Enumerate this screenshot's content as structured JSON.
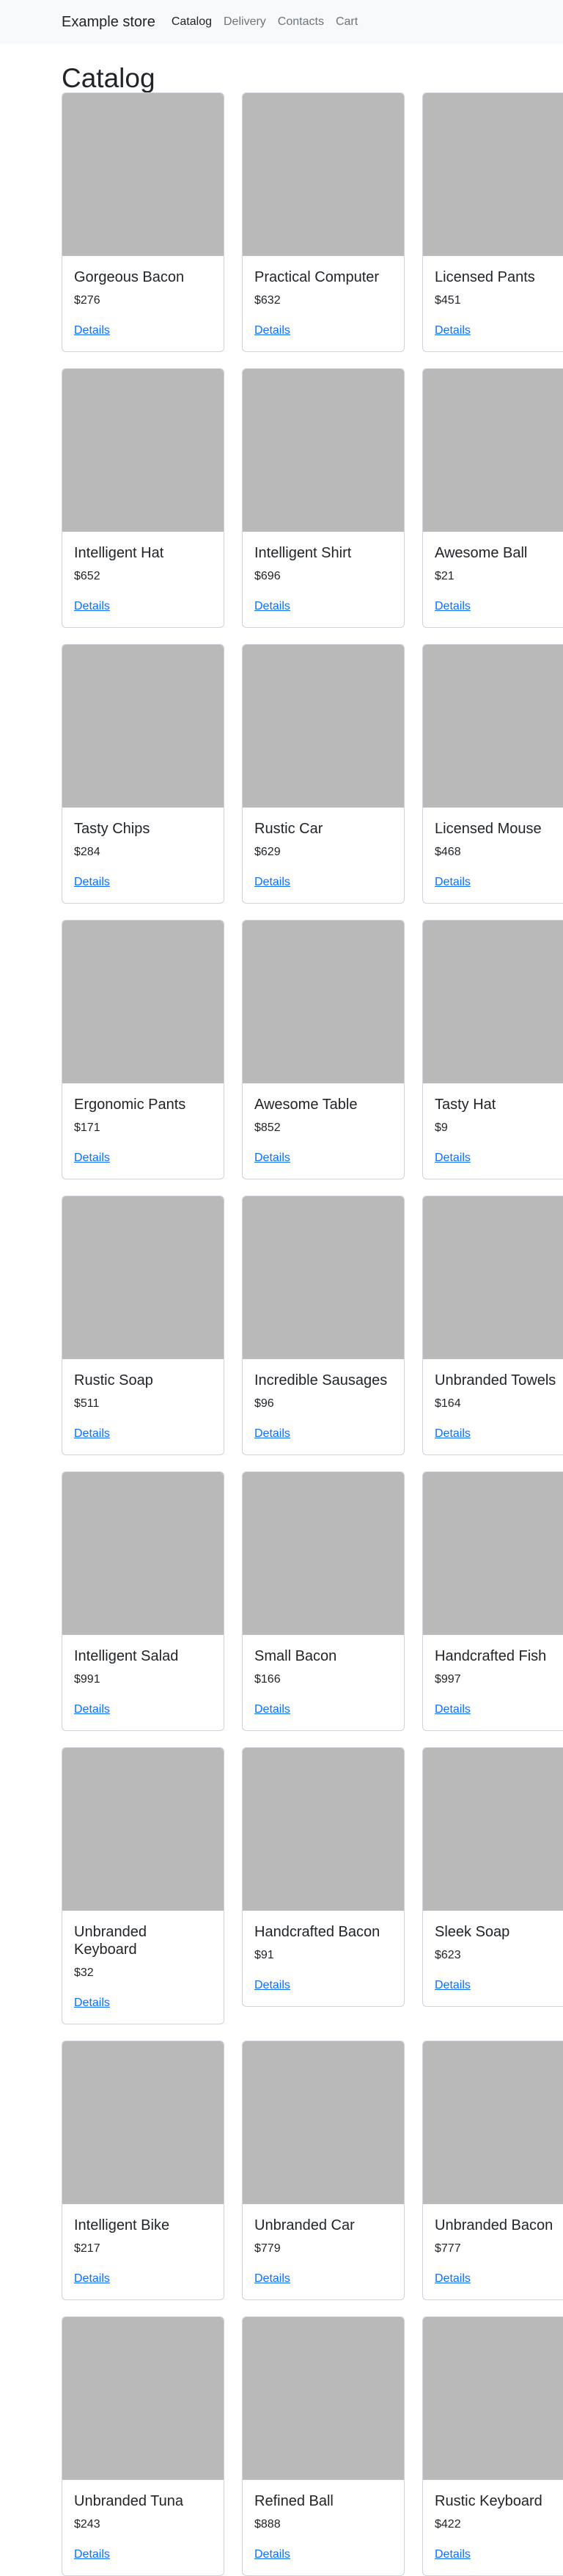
{
  "nav": {
    "brand": "Example store",
    "links": [
      "Catalog",
      "Delivery",
      "Contacts",
      "Cart"
    ]
  },
  "page": {
    "title": "Catalog"
  },
  "products": [
    {
      "name": "Gorgeous Bacon",
      "price": "$276",
      "link": "Details"
    },
    {
      "name": "Practical Computer",
      "price": "$632",
      "link": "Details"
    },
    {
      "name": "Licensed Pants",
      "price": "$451",
      "link": "Details"
    },
    {
      "name": "Intelligent Hat",
      "price": "$652",
      "link": "Details"
    },
    {
      "name": "Intelligent Shirt",
      "price": "$696",
      "link": "Details"
    },
    {
      "name": "Awesome Ball",
      "price": "$21",
      "link": "Details"
    },
    {
      "name": "Tasty Chips",
      "price": "$284",
      "link": "Details"
    },
    {
      "name": "Rustic Car",
      "price": "$629",
      "link": "Details"
    },
    {
      "name": "Licensed Mouse",
      "price": "$468",
      "link": "Details"
    },
    {
      "name": "Ergonomic Pants",
      "price": "$171",
      "link": "Details"
    },
    {
      "name": "Awesome Table",
      "price": "$852",
      "link": "Details"
    },
    {
      "name": "Tasty Hat",
      "price": "$9",
      "link": "Details"
    },
    {
      "name": "Rustic Soap",
      "price": "$511",
      "link": "Details"
    },
    {
      "name": "Incredible Sausages",
      "price": "$96",
      "link": "Details"
    },
    {
      "name": "Unbranded Towels",
      "price": "$164",
      "link": "Details"
    },
    {
      "name": "Intelligent Salad",
      "price": "$991",
      "link": "Details"
    },
    {
      "name": "Small Bacon",
      "price": "$166",
      "link": "Details"
    },
    {
      "name": "Handcrafted Fish",
      "price": "$997",
      "link": "Details"
    },
    {
      "name": "Unbranded Keyboard",
      "price": "$32",
      "link": "Details"
    },
    {
      "name": "Handcrafted Bacon",
      "price": "$91",
      "link": "Details"
    },
    {
      "name": "Sleek Soap",
      "price": "$623",
      "link": "Details"
    },
    {
      "name": "Intelligent Bike",
      "price": "$217",
      "link": "Details"
    },
    {
      "name": "Unbranded Car",
      "price": "$779",
      "link": "Details"
    },
    {
      "name": "Unbranded Bacon",
      "price": "$777",
      "link": "Details"
    },
    {
      "name": "Unbranded Tuna",
      "price": "$243",
      "link": "Details"
    },
    {
      "name": "Refined Ball",
      "price": "$888",
      "link": "Details"
    },
    {
      "name": "Rustic Keyboard",
      "price": "$422",
      "link": "Details"
    }
  ]
}
